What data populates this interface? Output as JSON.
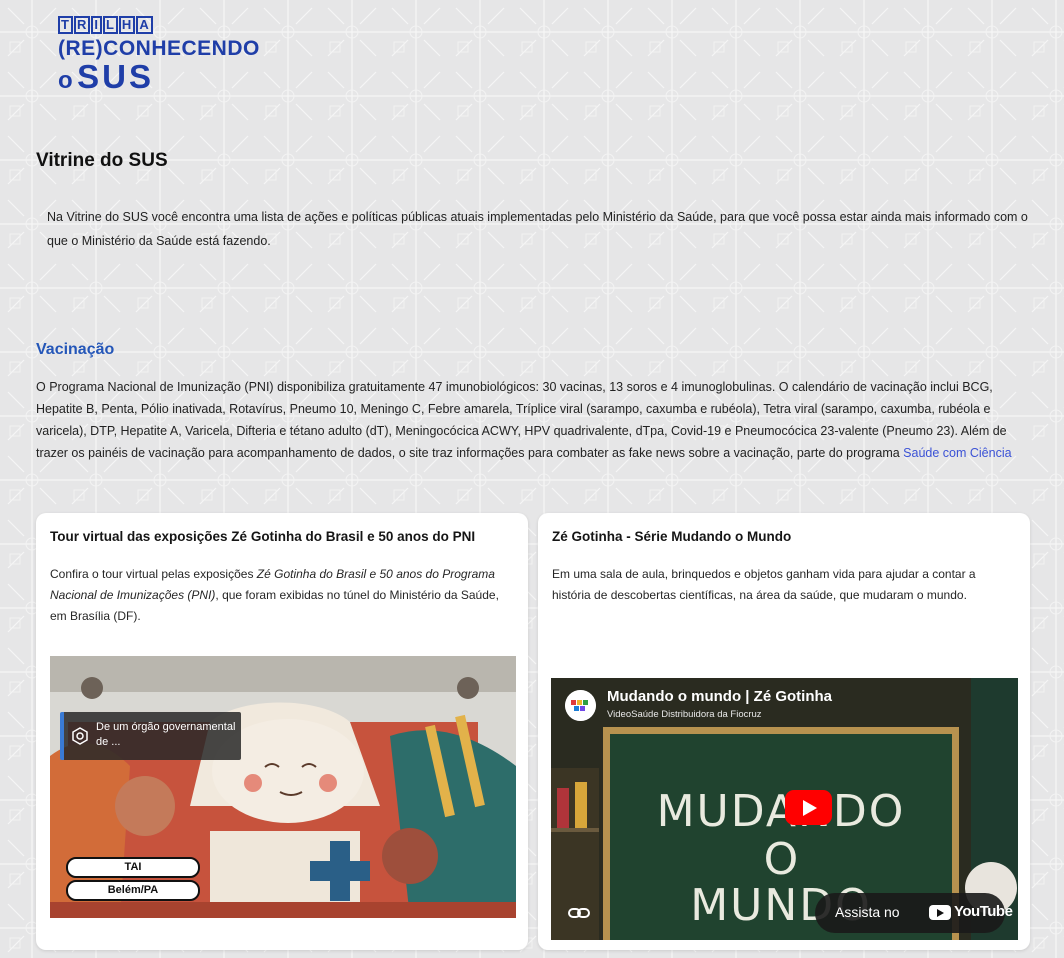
{
  "logo": {
    "line1": "TRILHA",
    "line2": "(RE)CONHECENDO",
    "line3_o": "o",
    "line3_sus": "SUS",
    "color": "#1f3ea8"
  },
  "vitrine": {
    "title": "Vitrine do SUS",
    "description": "Na Vitrine do SUS você encontra uma lista de ações e políticas públicas atuais implementadas pelo Ministério da Saúde, para que você possa estar ainda mais informado com o que o Ministério da Saúde está fazendo."
  },
  "vacinacao": {
    "title": "Vacinação",
    "title_color": "#2456b8",
    "text": "O Programa Nacional de Imunização (PNI) disponibiliza gratuitamente 47 imunobiológicos: 30 vacinas, 13 soros e 4 imunoglobulinas. O calendário de vacinação inclui BCG, Hepatite B, Penta, Pólio inativada, Rotavírus, Pneumo 10, Meningo C, Febre amarela, Tríplice viral (sarampo, caxumba e rubéola), Tetra viral (sarampo, caxumba, rubéola e varicela), DTP, Hepatite A, Varicela, Difteria e tétano adulto (dT), Meningocócica ACWY, HPV quadrivalente, dTpa, Covid-19 e Pneumocócica 23-valente (Pneumo 23). Além de trazer os painéis de vacinação para acompanhamento de dados, o site traz informações para combater as fake news sobre a vacinação, parte do programa",
    "link_text": "Saúde com Ciência"
  },
  "cards": [
    {
      "title": "Tour virtual das exposições Zé Gotinha do Brasil e 50 anos do PNI",
      "desc_before": "Confira o tour virtual pelas exposições ",
      "desc_italic": "Zé Gotinha do Brasil e 50 anos do Programa Nacional de Imunizações (PNI)",
      "desc_after": ", que foram exibidas no túnel do Ministério da Saúde, em Brasília (DF).",
      "media": {
        "badge_text": "De um órgão governamental de ...",
        "pill_1": "TAI",
        "pill_2": "Belém/PA"
      }
    },
    {
      "title": "Zé Gotinha - Série Mudando o Mundo",
      "desc": "Em uma sala de aula, brinquedos e objetos ganham vida para ajudar a contar a história de descobertas científicas, na área da saúde, que mudaram o mundo.",
      "video": {
        "title": "Mudando o mundo | Zé Gotinha",
        "channel": "VideoSaúde Distribuidora da Fiocruz",
        "board_line1": "MUDANDO",
        "board_line2": "O",
        "board_line3": "MUNDO",
        "watch_label": "Assista no",
        "youtube_word": "YouTube"
      }
    }
  ]
}
